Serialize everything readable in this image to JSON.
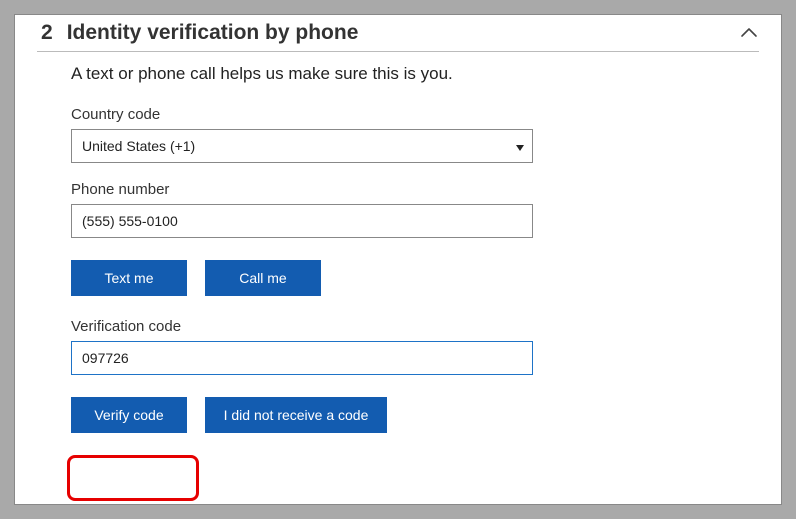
{
  "step_number": "2",
  "title": "Identity verification by phone",
  "subtitle": "A text or phone call helps us make sure this is you.",
  "country_code": {
    "label": "Country code",
    "selected": "United States (+1)"
  },
  "phone": {
    "label": "Phone number",
    "value": "(555) 555-0100"
  },
  "buttons": {
    "text_me": "Text me",
    "call_me": "Call me",
    "verify_code": "Verify code",
    "no_code": "I did not receive a code"
  },
  "verification": {
    "label": "Verification code",
    "value": "097726"
  }
}
